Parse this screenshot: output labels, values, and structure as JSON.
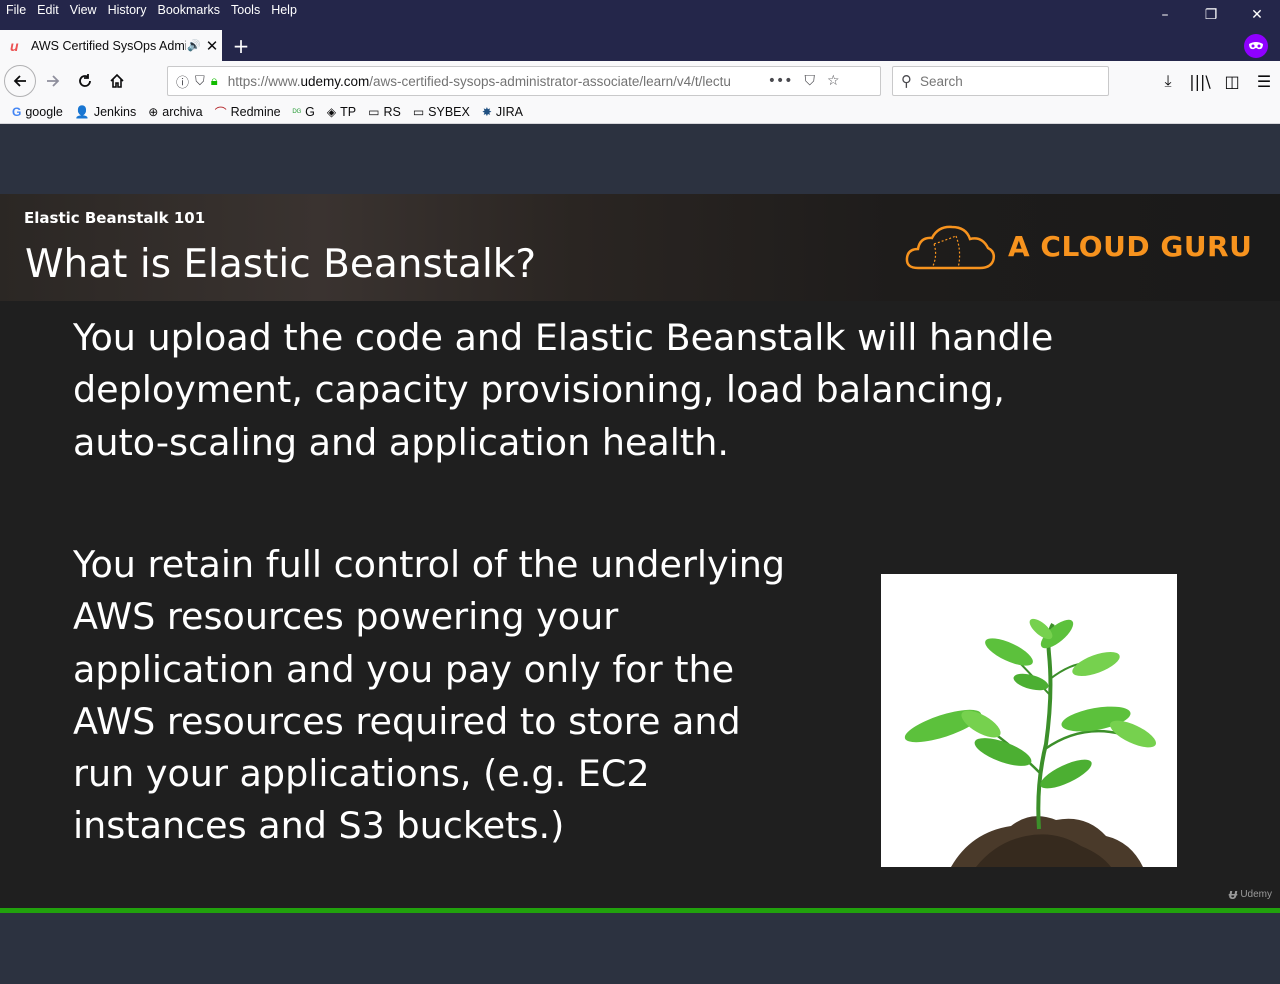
{
  "menu": [
    "File",
    "Edit",
    "View",
    "History",
    "Bookmarks",
    "Tools",
    "Help"
  ],
  "window_controls": {
    "minimize": "–",
    "restore": "❐",
    "close": "✕"
  },
  "tab": {
    "title": "AWS Certified SysOps Admi",
    "favicon": "u",
    "close": "✕",
    "speaker": "🔊"
  },
  "new_tab": "+",
  "url": {
    "prefix": "https://www.",
    "domain": "udemy.com",
    "path": "/aws-certified-sysops-administrator-associate/learn/v4/t/lectu"
  },
  "search": {
    "placeholder": "Search"
  },
  "bookmarks": [
    {
      "label": "google",
      "icon": "G"
    },
    {
      "label": "Jenkins",
      "icon": "👤"
    },
    {
      "label": "archiva",
      "icon": "⊕"
    },
    {
      "label": "Redmine",
      "icon": "⌒"
    },
    {
      "label": "G",
      "icon": "ᴰᴳ"
    },
    {
      "label": "TP",
      "icon": "◈"
    },
    {
      "label": "RS",
      "icon": "▭"
    },
    {
      "label": "SYBEX",
      "icon": "▭"
    },
    {
      "label": "JIRA",
      "icon": "✸"
    }
  ],
  "slide": {
    "kicker": "Elastic Beanstalk 101",
    "title": "What is Elastic Beanstalk?",
    "brand": "A CLOUD GURU",
    "para1": [
      "You upload the code and Elastic Beanstalk will handle",
      "deployment, capacity provisioning, load balancing,",
      "auto-scaling and application health."
    ],
    "para2": [
      "You retain full control of the underlying",
      "AWS resources powering your",
      "application and you pay only for the",
      "AWS resources required to store and",
      "run your applications, (e.g. EC2",
      "instances and S3 buckets.)"
    ],
    "watermark": "Udemy"
  },
  "colors": {
    "brand": "#f7931e",
    "progress": "#21a10d",
    "udemy": "#ec5252"
  }
}
